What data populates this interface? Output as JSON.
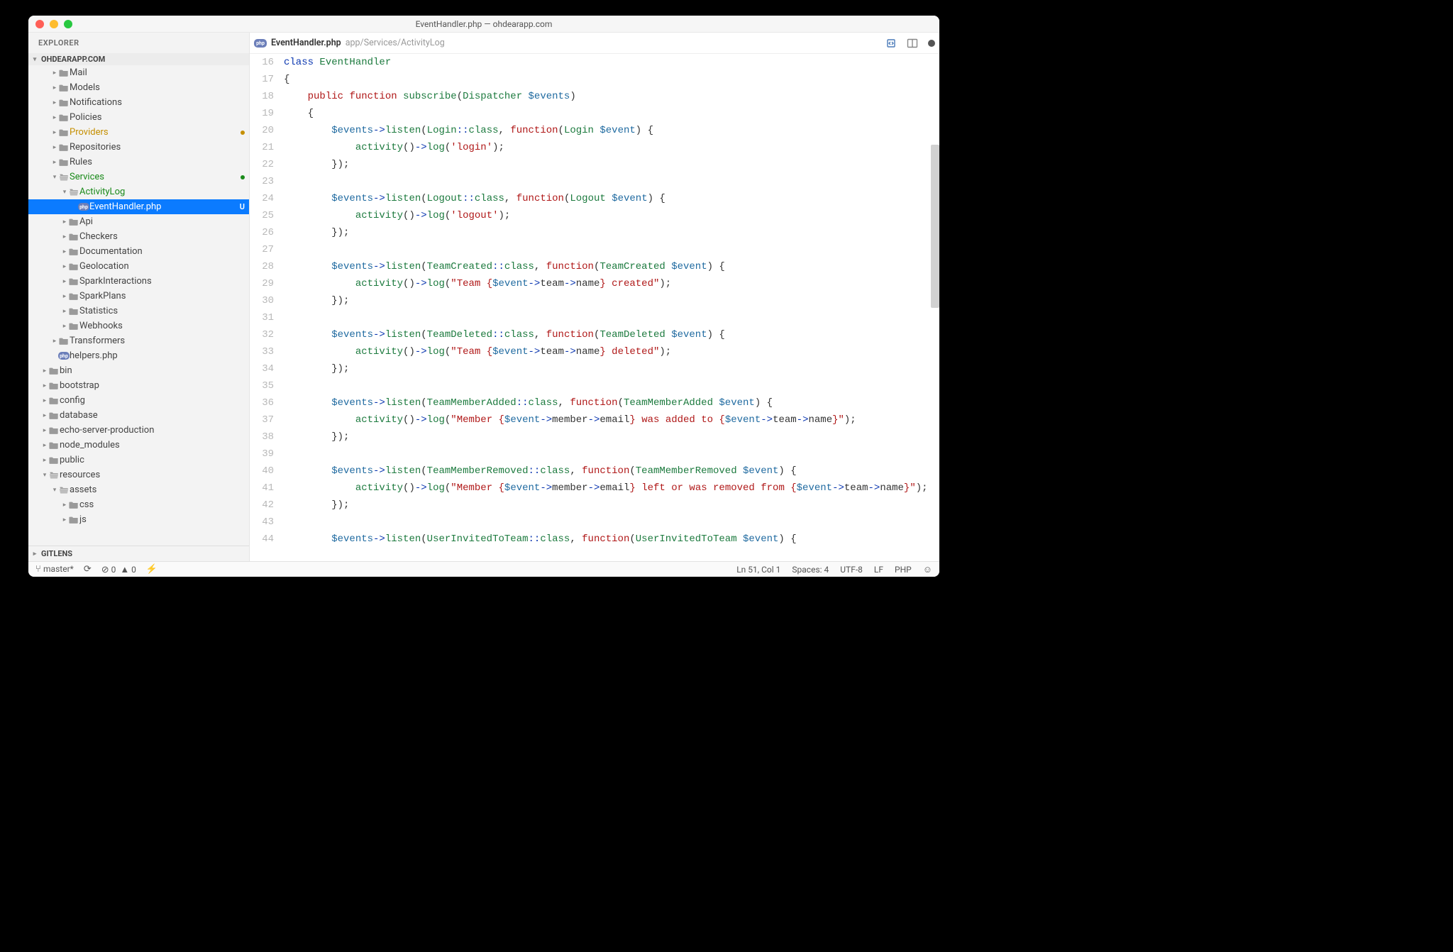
{
  "window": {
    "title": "EventHandler.php — ohdearapp.com"
  },
  "explorer": {
    "label": "EXPLORER",
    "project": "OHDEARAPP.COM",
    "gitlens": "GITLENS"
  },
  "status": {
    "branch": "master*",
    "errors": "0",
    "warnings": "0",
    "cursor": "Ln 51, Col 1",
    "spaces": "Spaces: 4",
    "encoding": "UTF-8",
    "eol": "LF",
    "lang": "PHP"
  },
  "tab": {
    "filename": "EventHandler.php",
    "path": "app/Services/ActivityLog"
  },
  "tree": [
    {
      "d": 1,
      "c": "▸",
      "i": "fold",
      "t": "Mail"
    },
    {
      "d": 1,
      "c": "▸",
      "i": "fold",
      "t": "Models"
    },
    {
      "d": 1,
      "c": "▸",
      "i": "fold",
      "t": "Notifications"
    },
    {
      "d": 1,
      "c": "▸",
      "i": "fold",
      "t": "Policies"
    },
    {
      "d": 1,
      "c": "▸",
      "i": "fold",
      "t": "Providers",
      "mod": true,
      "dot": "y"
    },
    {
      "d": 1,
      "c": "▸",
      "i": "fold",
      "t": "Repositories"
    },
    {
      "d": 1,
      "c": "▸",
      "i": "fold",
      "t": "Rules"
    },
    {
      "d": 1,
      "c": "▾",
      "i": "foldo",
      "t": "Services",
      "git": true,
      "dot": "g"
    },
    {
      "d": 2,
      "c": "▾",
      "i": "foldo",
      "t": "ActivityLog",
      "git": true
    },
    {
      "d": 3,
      "c": "",
      "i": "php",
      "t": "EventHandler.php",
      "sel": true,
      "badge": "U"
    },
    {
      "d": 2,
      "c": "▸",
      "i": "fold",
      "t": "Api"
    },
    {
      "d": 2,
      "c": "▸",
      "i": "fold",
      "t": "Checkers"
    },
    {
      "d": 2,
      "c": "▸",
      "i": "fold",
      "t": "Documentation"
    },
    {
      "d": 2,
      "c": "▸",
      "i": "fold",
      "t": "Geolocation"
    },
    {
      "d": 2,
      "c": "▸",
      "i": "fold",
      "t": "SparkInteractions"
    },
    {
      "d": 2,
      "c": "▸",
      "i": "fold",
      "t": "SparkPlans"
    },
    {
      "d": 2,
      "c": "▸",
      "i": "fold",
      "t": "Statistics"
    },
    {
      "d": 2,
      "c": "▸",
      "i": "fold",
      "t": "Webhooks"
    },
    {
      "d": 1,
      "c": "▸",
      "i": "fold",
      "t": "Transformers"
    },
    {
      "d": 1,
      "c": "",
      "i": "php",
      "t": "helpers.php"
    },
    {
      "d": 0,
      "c": "▸",
      "i": "fold",
      "t": "bin"
    },
    {
      "d": 0,
      "c": "▸",
      "i": "fold",
      "t": "bootstrap"
    },
    {
      "d": 0,
      "c": "▸",
      "i": "fold",
      "t": "config"
    },
    {
      "d": 0,
      "c": "▸",
      "i": "fold",
      "t": "database"
    },
    {
      "d": 0,
      "c": "▸",
      "i": "fold",
      "t": "echo-server-production"
    },
    {
      "d": 0,
      "c": "▸",
      "i": "fold",
      "t": "node_modules"
    },
    {
      "d": 0,
      "c": "▸",
      "i": "fold",
      "t": "public"
    },
    {
      "d": 0,
      "c": "▾",
      "i": "foldo",
      "t": "resources"
    },
    {
      "d": 1,
      "c": "▾",
      "i": "foldo",
      "t": "assets"
    },
    {
      "d": 2,
      "c": "▸",
      "i": "fold",
      "t": "css"
    },
    {
      "d": 2,
      "c": "▸",
      "i": "fold",
      "t": "js"
    }
  ],
  "code": {
    "first_line": 16,
    "lines": [
      [
        [
          "kw",
          "class"
        ],
        [
          "id",
          " "
        ],
        [
          "cls",
          "EventHandler"
        ]
      ],
      [
        [
          "id",
          "{"
        ]
      ],
      [
        [
          "id",
          "    "
        ],
        [
          "kwr",
          "public"
        ],
        [
          "id",
          " "
        ],
        [
          "kwr",
          "function"
        ],
        [
          "id",
          " "
        ],
        [
          "fn",
          "subscribe"
        ],
        [
          "id",
          "("
        ],
        [
          "cls",
          "Dispatcher"
        ],
        [
          "id",
          " "
        ],
        [
          "var",
          "$events"
        ],
        [
          "id",
          ")"
        ]
      ],
      [
        [
          "id",
          "    {"
        ]
      ],
      [
        [
          "id",
          "        "
        ],
        [
          "var",
          "$events"
        ],
        [
          "op",
          "->"
        ],
        [
          "fn",
          "listen"
        ],
        [
          "id",
          "("
        ],
        [
          "cls",
          "Login"
        ],
        [
          "op",
          "::"
        ],
        [
          "cw",
          "class"
        ],
        [
          "id",
          ", "
        ],
        [
          "kwr",
          "function"
        ],
        [
          "id",
          "("
        ],
        [
          "cls",
          "Login"
        ],
        [
          "id",
          " "
        ],
        [
          "var",
          "$event"
        ],
        [
          "id",
          ") {"
        ]
      ],
      [
        [
          "id",
          "            "
        ],
        [
          "fn",
          "activity"
        ],
        [
          "id",
          "()"
        ],
        [
          "op",
          "->"
        ],
        [
          "fn",
          "log"
        ],
        [
          "id",
          "("
        ],
        [
          "str",
          "'login'"
        ],
        [
          "id",
          ");"
        ]
      ],
      [
        [
          "id",
          "        });"
        ]
      ],
      [
        [
          "id",
          ""
        ]
      ],
      [
        [
          "id",
          "        "
        ],
        [
          "var",
          "$events"
        ],
        [
          "op",
          "->"
        ],
        [
          "fn",
          "listen"
        ],
        [
          "id",
          "("
        ],
        [
          "cls",
          "Logout"
        ],
        [
          "op",
          "::"
        ],
        [
          "cw",
          "class"
        ],
        [
          "id",
          ", "
        ],
        [
          "kwr",
          "function"
        ],
        [
          "id",
          "("
        ],
        [
          "cls",
          "Logout"
        ],
        [
          "id",
          " "
        ],
        [
          "var",
          "$event"
        ],
        [
          "id",
          ") {"
        ]
      ],
      [
        [
          "id",
          "            "
        ],
        [
          "fn",
          "activity"
        ],
        [
          "id",
          "()"
        ],
        [
          "op",
          "->"
        ],
        [
          "fn",
          "log"
        ],
        [
          "id",
          "("
        ],
        [
          "str",
          "'logout'"
        ],
        [
          "id",
          ");"
        ]
      ],
      [
        [
          "id",
          "        });"
        ]
      ],
      [
        [
          "id",
          ""
        ]
      ],
      [
        [
          "id",
          "        "
        ],
        [
          "var",
          "$events"
        ],
        [
          "op",
          "->"
        ],
        [
          "fn",
          "listen"
        ],
        [
          "id",
          "("
        ],
        [
          "cls",
          "TeamCreated"
        ],
        [
          "op",
          "::"
        ],
        [
          "cw",
          "class"
        ],
        [
          "id",
          ", "
        ],
        [
          "kwr",
          "function"
        ],
        [
          "id",
          "("
        ],
        [
          "cls",
          "TeamCreated"
        ],
        [
          "id",
          " "
        ],
        [
          "var",
          "$event"
        ],
        [
          "id",
          ") {"
        ]
      ],
      [
        [
          "id",
          "            "
        ],
        [
          "fn",
          "activity"
        ],
        [
          "id",
          "()"
        ],
        [
          "op",
          "->"
        ],
        [
          "fn",
          "log"
        ],
        [
          "id",
          "("
        ],
        [
          "str",
          "\"Team {"
        ],
        [
          "var",
          "$event"
        ],
        [
          "op",
          "->"
        ],
        [
          "id",
          "team"
        ],
        [
          "op",
          "->"
        ],
        [
          "id",
          "name"
        ],
        [
          "str",
          "} created\""
        ],
        [
          "id",
          ");"
        ]
      ],
      [
        [
          "id",
          "        });"
        ]
      ],
      [
        [
          "id",
          ""
        ]
      ],
      [
        [
          "id",
          "        "
        ],
        [
          "var",
          "$events"
        ],
        [
          "op",
          "->"
        ],
        [
          "fn",
          "listen"
        ],
        [
          "id",
          "("
        ],
        [
          "cls",
          "TeamDeleted"
        ],
        [
          "op",
          "::"
        ],
        [
          "cw",
          "class"
        ],
        [
          "id",
          ", "
        ],
        [
          "kwr",
          "function"
        ],
        [
          "id",
          "("
        ],
        [
          "cls",
          "TeamDeleted"
        ],
        [
          "id",
          " "
        ],
        [
          "var",
          "$event"
        ],
        [
          "id",
          ") {"
        ]
      ],
      [
        [
          "id",
          "            "
        ],
        [
          "fn",
          "activity"
        ],
        [
          "id",
          "()"
        ],
        [
          "op",
          "->"
        ],
        [
          "fn",
          "log"
        ],
        [
          "id",
          "("
        ],
        [
          "str",
          "\"Team {"
        ],
        [
          "var",
          "$event"
        ],
        [
          "op",
          "->"
        ],
        [
          "id",
          "team"
        ],
        [
          "op",
          "->"
        ],
        [
          "id",
          "name"
        ],
        [
          "str",
          "} deleted\""
        ],
        [
          "id",
          ");"
        ]
      ],
      [
        [
          "id",
          "        });"
        ]
      ],
      [
        [
          "id",
          ""
        ]
      ],
      [
        [
          "id",
          "        "
        ],
        [
          "var",
          "$events"
        ],
        [
          "op",
          "->"
        ],
        [
          "fn",
          "listen"
        ],
        [
          "id",
          "("
        ],
        [
          "cls",
          "TeamMemberAdded"
        ],
        [
          "op",
          "::"
        ],
        [
          "cw",
          "class"
        ],
        [
          "id",
          ", "
        ],
        [
          "kwr",
          "function"
        ],
        [
          "id",
          "("
        ],
        [
          "cls",
          "TeamMemberAdded"
        ],
        [
          "id",
          " "
        ],
        [
          "var",
          "$event"
        ],
        [
          "id",
          ") {"
        ]
      ],
      [
        [
          "id",
          "            "
        ],
        [
          "fn",
          "activity"
        ],
        [
          "id",
          "()"
        ],
        [
          "op",
          "->"
        ],
        [
          "fn",
          "log"
        ],
        [
          "id",
          "("
        ],
        [
          "str",
          "\"Member {"
        ],
        [
          "var",
          "$event"
        ],
        [
          "op",
          "->"
        ],
        [
          "id",
          "member"
        ],
        [
          "op",
          "->"
        ],
        [
          "id",
          "email"
        ],
        [
          "str",
          "} was added to {"
        ],
        [
          "var",
          "$event"
        ],
        [
          "op",
          "->"
        ],
        [
          "id",
          "team"
        ],
        [
          "op",
          "->"
        ],
        [
          "id",
          "name"
        ],
        [
          "str",
          "}\""
        ],
        [
          "id",
          ");"
        ]
      ],
      [
        [
          "id",
          "        });"
        ]
      ],
      [
        [
          "id",
          ""
        ]
      ],
      [
        [
          "id",
          "        "
        ],
        [
          "var",
          "$events"
        ],
        [
          "op",
          "->"
        ],
        [
          "fn",
          "listen"
        ],
        [
          "id",
          "("
        ],
        [
          "cls",
          "TeamMemberRemoved"
        ],
        [
          "op",
          "::"
        ],
        [
          "cw",
          "class"
        ],
        [
          "id",
          ", "
        ],
        [
          "kwr",
          "function"
        ],
        [
          "id",
          "("
        ],
        [
          "cls",
          "TeamMemberRemoved"
        ],
        [
          "id",
          " "
        ],
        [
          "var",
          "$event"
        ],
        [
          "id",
          ") {"
        ]
      ],
      [
        [
          "id",
          "            "
        ],
        [
          "fn",
          "activity"
        ],
        [
          "id",
          "()"
        ],
        [
          "op",
          "->"
        ],
        [
          "fn",
          "log"
        ],
        [
          "id",
          "("
        ],
        [
          "str",
          "\"Member {"
        ],
        [
          "var",
          "$event"
        ],
        [
          "op",
          "->"
        ],
        [
          "id",
          "member"
        ],
        [
          "op",
          "->"
        ],
        [
          "id",
          "email"
        ],
        [
          "str",
          "} left or was removed from {"
        ],
        [
          "var",
          "$event"
        ],
        [
          "op",
          "->"
        ],
        [
          "id",
          "team"
        ],
        [
          "op",
          "->"
        ],
        [
          "id",
          "name"
        ],
        [
          "str",
          "}\""
        ],
        [
          "id",
          ");"
        ]
      ],
      [
        [
          "id",
          "        });"
        ]
      ],
      [
        [
          "id",
          ""
        ]
      ],
      [
        [
          "id",
          "        "
        ],
        [
          "var",
          "$events"
        ],
        [
          "op",
          "->"
        ],
        [
          "fn",
          "listen"
        ],
        [
          "id",
          "("
        ],
        [
          "cls",
          "UserInvitedToTeam"
        ],
        [
          "op",
          "::"
        ],
        [
          "cw",
          "class"
        ],
        [
          "id",
          ", "
        ],
        [
          "kwr",
          "function"
        ],
        [
          "id",
          "("
        ],
        [
          "cls",
          "UserInvitedToTeam"
        ],
        [
          "id",
          " "
        ],
        [
          "var",
          "$event"
        ],
        [
          "id",
          ") {"
        ]
      ]
    ]
  }
}
